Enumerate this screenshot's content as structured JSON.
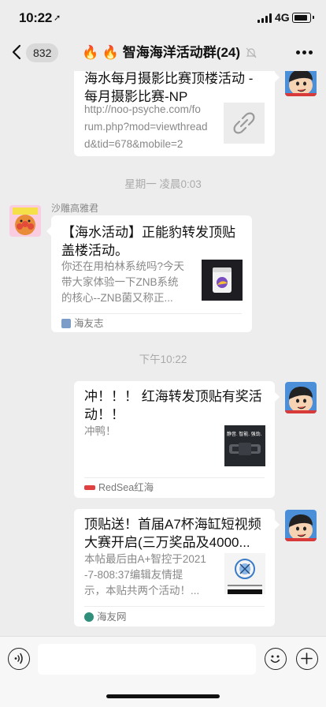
{
  "status_bar": {
    "time": "10:22",
    "location_arrow": "➚",
    "network": "4G"
  },
  "header": {
    "unread_count": "832",
    "title": "🔥 🔥 智海海洋活动群(24)",
    "back_icon": "chevron-left-icon",
    "mute_icon": "bell-slash-icon",
    "more_icon": "ellipsis-icon"
  },
  "messages": {
    "m1": {
      "title_lines": [
        "海水每月摄影比赛顶楼活动 -",
        "每月摄影比赛-NP"
      ],
      "url_lines": [
        "http://noo-psyche.com/fo",
        "rum.php?mod=viewthread",
        "d&tid=678&mobile=2"
      ],
      "thumb_icon": "link-icon"
    },
    "time1": "星期一 凌晨0:03",
    "m2": {
      "sender": "沙雕高雅君",
      "title_lines": [
        "【海水活动】正能豹转发顶贴",
        "盖楼活动。"
      ],
      "desc_lines": [
        "你还在用柏林系统吗?今天",
        "带大家体验一下ZNB系统",
        "的核心--ZNB菌又称正..."
      ],
      "source": "海友志"
    },
    "time2": "下午10:22",
    "m3": {
      "title_lines": [
        "冲！！！ 红海转发顶贴有奖活",
        "动！！"
      ],
      "desc": "冲鸭！",
      "source": "RedSea红海",
      "thumb_caption": "静音. 智能. 强劲."
    },
    "m4": {
      "title_lines": [
        "顶贴送！首届A7杯海缸短视频",
        "大赛开启(三万奖品及4000..."
      ],
      "desc_lines": [
        "本帖最后由A+智控于2021",
        "-7-808:37编辑友情提",
        "示，本贴共两个活动！..."
      ],
      "source": "海友网"
    }
  },
  "input_bar": {
    "placeholder": "",
    "voice_icon": "voice-icon",
    "emoji_icon": "smiley-icon",
    "plus_icon": "plus-icon"
  }
}
